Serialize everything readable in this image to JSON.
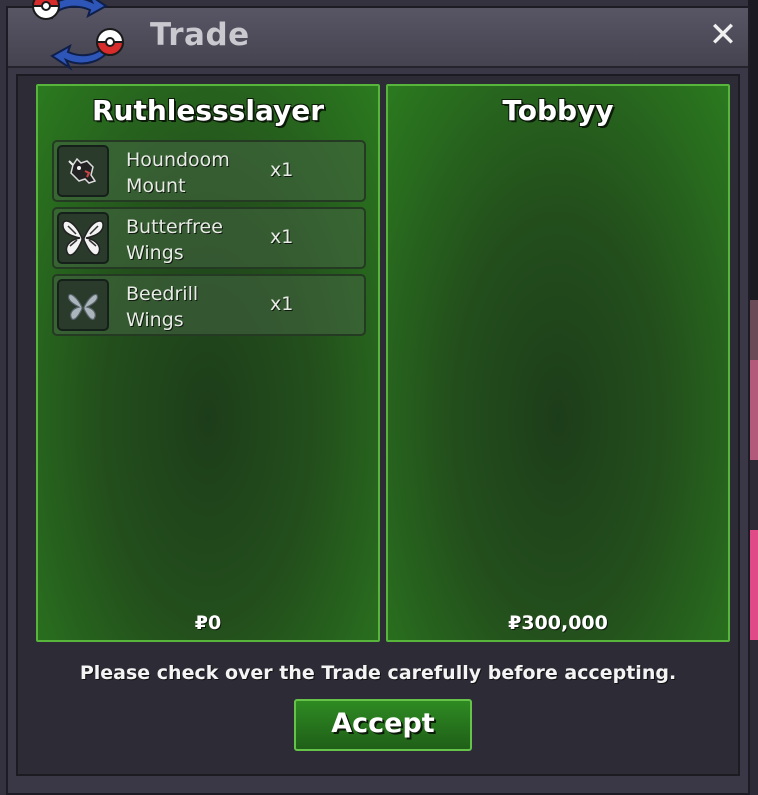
{
  "window": {
    "title": "Trade",
    "close_label": "✕"
  },
  "left_panel": {
    "player": "Ruthlessslayer",
    "items": [
      {
        "name": "Houndoom Mount",
        "qty": "x1",
        "icon": "houndoom-mount-icon"
      },
      {
        "name": "Butterfree Wings",
        "qty": "x1",
        "icon": "butterfree-wings-icon"
      },
      {
        "name": "Beedrill Wings",
        "qty": "x1",
        "icon": "beedrill-wings-icon"
      }
    ],
    "money": "₽0"
  },
  "right_panel": {
    "player": "Tobbyy",
    "items": [],
    "money": "₽300,000"
  },
  "footer": {
    "notice": "Please check over the Trade carefully before accepting.",
    "accept_label": "Accept"
  },
  "colors": {
    "panel_green": "#2b7a1f",
    "panel_border": "#56b53a",
    "window_bg": "#3a3846"
  }
}
